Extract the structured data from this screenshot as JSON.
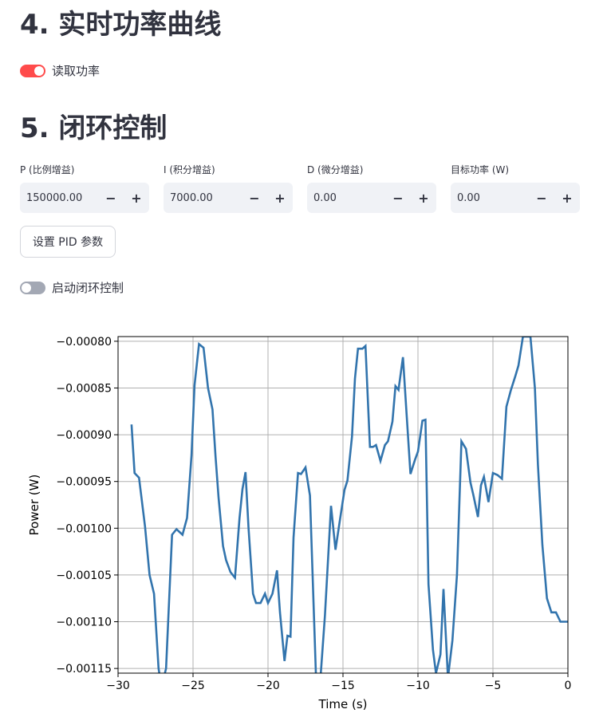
{
  "section4": {
    "title": "4. 实时功率曲线",
    "toggle_label": "读取功率",
    "toggle_on": true
  },
  "section5": {
    "title": "5. 闭环控制",
    "fields": [
      {
        "label": "P (比例增益)",
        "value": "150000.00"
      },
      {
        "label": "I (积分增益)",
        "value": "7000.00"
      },
      {
        "label": "D (微分增益)",
        "value": "0.00"
      },
      {
        "label": "目标功率 (W)",
        "value": "0.00"
      }
    ],
    "minus": "−",
    "plus": "+",
    "set_button": "设置 PID 参数",
    "toggle_label": "启动闭环控制",
    "toggle_on": false
  },
  "colors": {
    "accent": "#ff4b4b",
    "line": "#3274ad"
  },
  "chart_data": {
    "type": "line",
    "xlabel": "Time (s)",
    "ylabel": "Power (W)",
    "xlim": [
      -30,
      0
    ],
    "ylim": [
      -0.001155,
      -0.000795
    ],
    "xticks": [
      -30,
      -25,
      -20,
      -15,
      -10,
      -5,
      0
    ],
    "xtick_labels": [
      "−30",
      "−25",
      "−20",
      "−15",
      "−10",
      "−5",
      "0"
    ],
    "yticks": [
      -0.0008,
      -0.00085,
      -0.0009,
      -0.00095,
      -0.001,
      -0.00105,
      -0.0011,
      -0.00115
    ],
    "ytick_labels": [
      "−0.00080",
      "−0.00085",
      "−0.00090",
      "−0.00095",
      "−0.00100",
      "−0.00105",
      "−0.00110",
      "−0.00115"
    ],
    "grid": true,
    "series": [
      {
        "x": [
          -29.1,
          -28.9,
          -28.6,
          -28.2,
          -27.9,
          -27.6,
          -27.3,
          -27.1,
          -26.8,
          -26.4,
          -26.1,
          -25.7,
          -25.4,
          -25.1,
          -24.9,
          -24.6,
          -24.3,
          -24,
          -23.7,
          -23.5,
          -23.3,
          -23,
          -22.8,
          -22.5,
          -22.2,
          -21.9,
          -21.7,
          -21.5,
          -21.3,
          -21,
          -20.8,
          -20.5,
          -20.2,
          -20,
          -19.7,
          -19.4,
          -19.2,
          -18.9,
          -18.7,
          -18.5,
          -18.3,
          -18,
          -17.8,
          -17.5,
          -17.2,
          -16.8,
          -16.5,
          -16.2,
          -15.8,
          -15.5,
          -15.2,
          -14.9,
          -14.7,
          -14.4,
          -14.2,
          -14,
          -13.7,
          -13.5,
          -13.2,
          -13,
          -12.8,
          -12.5,
          -12.2,
          -12,
          -11.7,
          -11.5,
          -11.3,
          -11,
          -10.8,
          -10.5,
          -10.2,
          -10,
          -9.7,
          -9.5,
          -9.3,
          -9,
          -8.8,
          -8.5,
          -8.3,
          -8,
          -7.7,
          -7.4,
          -7.1,
          -6.8,
          -6.5,
          -6.3,
          -6,
          -5.8,
          -5.6,
          -5.3,
          -5,
          -4.7,
          -4.4,
          -4.1,
          -3.8,
          -3.5,
          -3.3,
          -3,
          -2.8,
          -2.5,
          -2.2,
          -2,
          -1.7,
          -1.4,
          -1.1,
          -0.8,
          -0.5,
          -0.2,
          0
        ],
        "y": [
          -0.000889,
          -0.000941,
          -0.000946,
          -0.000998,
          -0.00105,
          -0.00107,
          -0.00115,
          -0.00117,
          -0.00115,
          -0.001007,
          -0.001001,
          -0.001007,
          -0.000989,
          -0.000922,
          -0.000847,
          -0.000803,
          -0.000807,
          -0.00085,
          -0.000873,
          -0.000923,
          -0.000967,
          -0.001019,
          -0.001034,
          -0.001047,
          -0.001053,
          -0.000989,
          -0.000958,
          -0.00094,
          -0.001,
          -0.00107,
          -0.00108,
          -0.00108,
          -0.00107,
          -0.00108,
          -0.00107,
          -0.001045,
          -0.00109,
          -0.001142,
          -0.001115,
          -0.001116,
          -0.00101,
          -0.000941,
          -0.000942,
          -0.000935,
          -0.000965,
          -0.00116,
          -0.00116,
          -0.001093,
          -0.000976,
          -0.001023,
          -0.000991,
          -0.000959,
          -0.000949,
          -0.000902,
          -0.00084,
          -0.000808,
          -0.000808,
          -0.000805,
          -0.000913,
          -0.000913,
          -0.000911,
          -0.000928,
          -0.000911,
          -0.000907,
          -0.000886,
          -0.000848,
          -0.000852,
          -0.000817,
          -0.000868,
          -0.000942,
          -0.000927,
          -0.000918,
          -0.000885,
          -0.000884,
          -0.00106,
          -0.00113,
          -0.001155,
          -0.001135,
          -0.001065,
          -0.00116,
          -0.00112,
          -0.00105,
          -0.000907,
          -0.000915,
          -0.000951,
          -0.000965,
          -0.000988,
          -0.000954,
          -0.000945,
          -0.000972,
          -0.000941,
          -0.000943,
          -0.000947,
          -0.00087,
          -0.000852,
          -0.000837,
          -0.000826,
          -0.000795,
          -0.000795,
          -0.000795,
          -0.00085,
          -0.000932,
          -0.001018,
          -0.001075,
          -0.00109,
          -0.00109,
          -0.0011,
          -0.0011,
          -0.0011
        ]
      }
    ]
  }
}
